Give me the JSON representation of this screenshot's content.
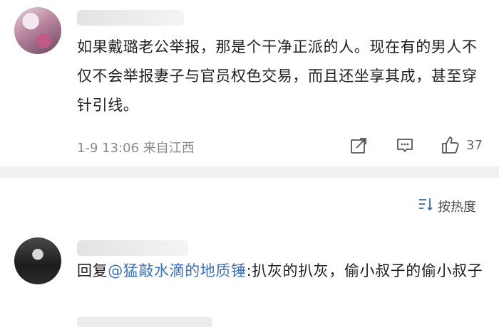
{
  "comments": [
    {
      "text": "如果戴璐老公举报，那是个干净正派的人。现在有的男人不仅不会举报妻子与官员权色交易，而且还坐享其成，甚至穿针引线。",
      "time": "1-9 13:06",
      "location": "来自江西",
      "likes": "37"
    },
    {
      "reply_prefix": "回复",
      "mention": "@猛敲水滴的地质锤",
      "text": ":扒灰的扒灰，偷小叔子的偷小叔子"
    }
  ],
  "sort": {
    "label": "按热度"
  }
}
